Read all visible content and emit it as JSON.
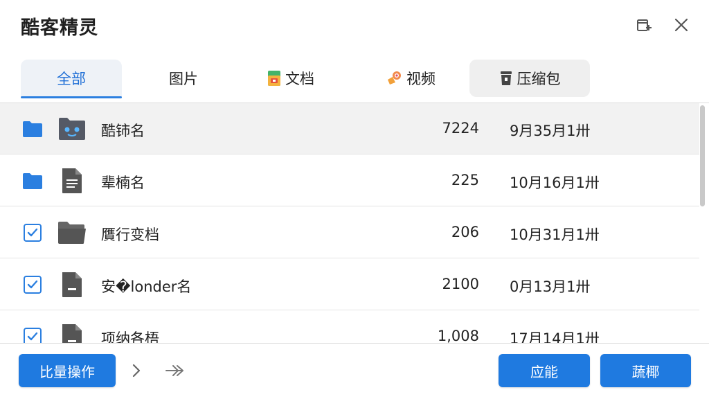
{
  "app": {
    "title": "酷客精灵"
  },
  "window": {
    "pin_icon": "window-pin-icon",
    "close_icon": "close-icon"
  },
  "tabs": [
    {
      "label": "全部",
      "active": true
    },
    {
      "label": "图片",
      "active": false
    },
    {
      "label": "文档",
      "icon": "document-icon",
      "active": false
    },
    {
      "label": "视频",
      "icon": "video-icon",
      "active": false
    },
    {
      "label": "压缩包",
      "icon": "archive-icon",
      "active": false
    }
  ],
  "files": [
    {
      "name": "酷铈名",
      "size": "7224",
      "date": "9月35月1卅",
      "lead": "folder",
      "icon": "robot-face-icon",
      "checked": false,
      "highlighted": true
    },
    {
      "name": "辈楠名",
      "size": "225",
      "date": "10月16月1卅",
      "lead": "folder",
      "icon": "document-icon",
      "checked": false,
      "highlighted": false
    },
    {
      "name": "贋行变档",
      "size": "206",
      "date": "10月31月1卅",
      "lead": "checkbox",
      "icon": "folder-open-icon",
      "checked": true,
      "highlighted": false
    },
    {
      "name": "安�londer名",
      "size": "2100",
      "date": "0月13月1卅",
      "lead": "checkbox",
      "icon": "file-icon",
      "checked": true,
      "highlighted": false
    },
    {
      "name": "项纳各梧",
      "size": "1,008",
      "date": "17月14月1卅",
      "lead": "checkbox",
      "icon": "file-icon",
      "checked": true,
      "highlighted": false
    }
  ],
  "footer": {
    "batch_label": "比量操作",
    "apply_label": "应能",
    "last_label": "蔬椰"
  },
  "colors": {
    "accent": "#1f7ae0",
    "folder": "#2b7fe0",
    "file_icon": "#555555"
  }
}
